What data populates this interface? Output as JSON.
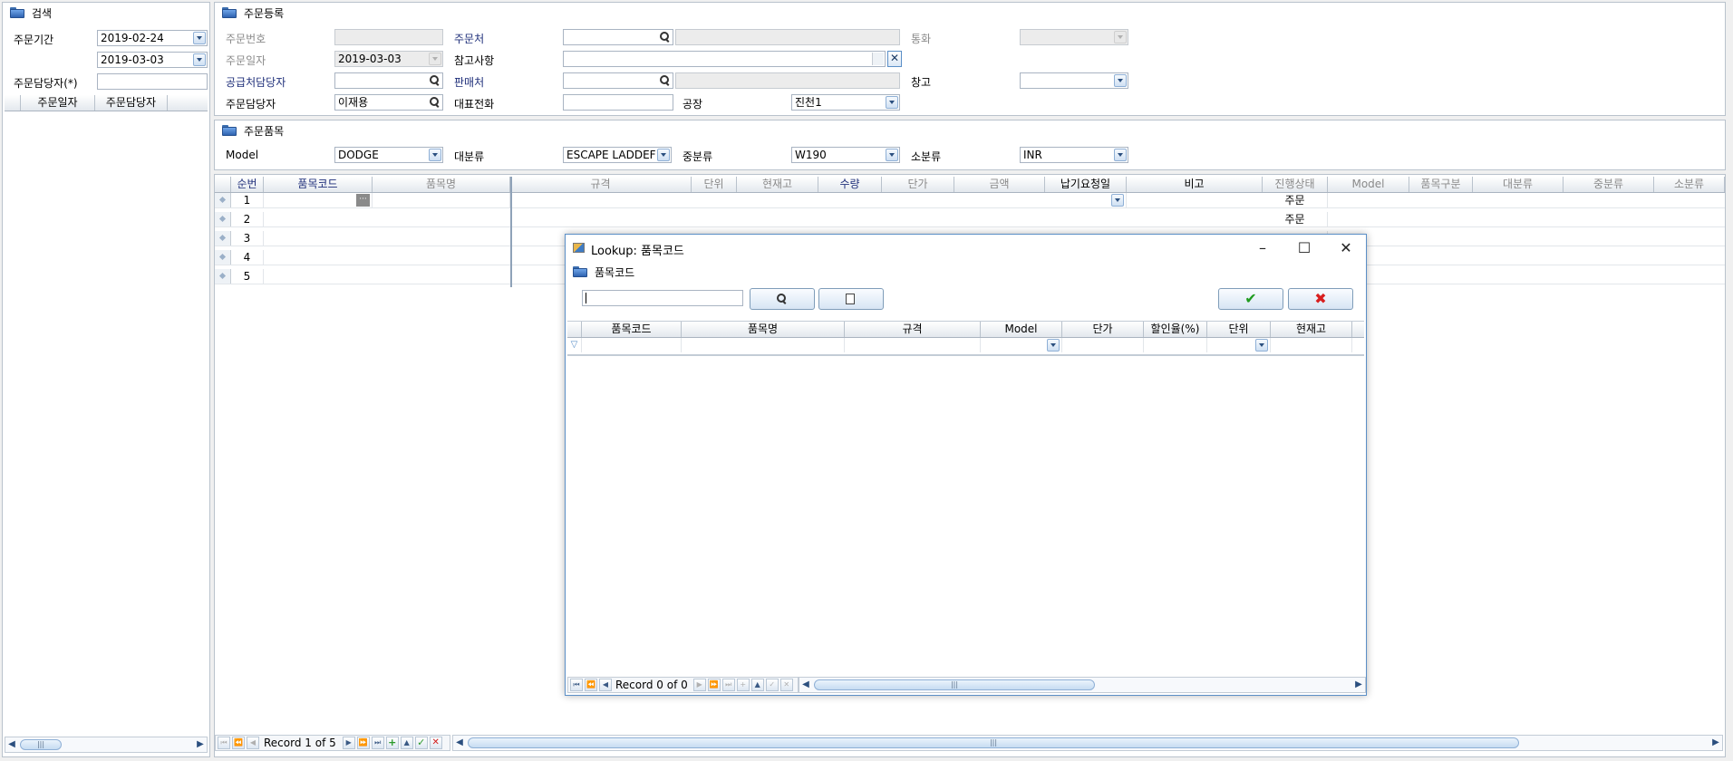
{
  "search_panel": {
    "title": "검색",
    "period_label": "주문기간",
    "date_from": "2019-02-24",
    "date_to": "2019-03-03",
    "manager_label": "주문담당자(*)",
    "manager_value": "",
    "columns": [
      "주문일자",
      "주문담당자"
    ]
  },
  "order_reg": {
    "title": "주문등록",
    "order_no_label": "주문번호",
    "order_no": "",
    "order_date_label": "주문일자",
    "order_date": "2019-03-03",
    "supplier_mgr_label": "공급처담당자",
    "order_mgr_label": "주문담당자",
    "order_mgr": "이재용",
    "customer_label": "주문처",
    "note_label": "참고사항",
    "seller_label": "판매처",
    "phone_label": "대표전화",
    "currency_label": "통화",
    "warehouse_label": "창고",
    "factory_label": "공장",
    "factory": "진천1"
  },
  "order_items": {
    "title": "주문품목",
    "model_label": "Model",
    "model": "DODGE",
    "major_label": "대분류",
    "major": "ESCAPE LADDEF",
    "middle_label": "중분류",
    "middle": "W190",
    "minor_label": "소분류",
    "minor": "INR"
  },
  "main_grid": {
    "columns": [
      "순번",
      "품목코드",
      "품목명",
      "규격",
      "단위",
      "현재고",
      "수량",
      "단가",
      "금액",
      "납기요청일",
      "비고",
      "진행상태",
      "Model",
      "품목구분",
      "대분류",
      "중분류",
      "소분류"
    ],
    "rows": [
      {
        "no": "1",
        "status": "주문"
      },
      {
        "no": "2",
        "status": "주문"
      },
      {
        "no": "3",
        "status": ""
      },
      {
        "no": "4",
        "status": ""
      },
      {
        "no": "5",
        "status": ""
      }
    ],
    "record_text": "Record 1 of 5"
  },
  "lookup": {
    "title": "Lookup: 품목코드",
    "section": "품목코드",
    "search_value": "",
    "columns": [
      "품목코드",
      "품목명",
      "규격",
      "Model",
      "단가",
      "할인율(%)",
      "단위",
      "현재고"
    ],
    "record_text": "Record 0 of 0"
  },
  "colors": {
    "accent": "#5b8fc7",
    "border": "#b9c2cc"
  }
}
